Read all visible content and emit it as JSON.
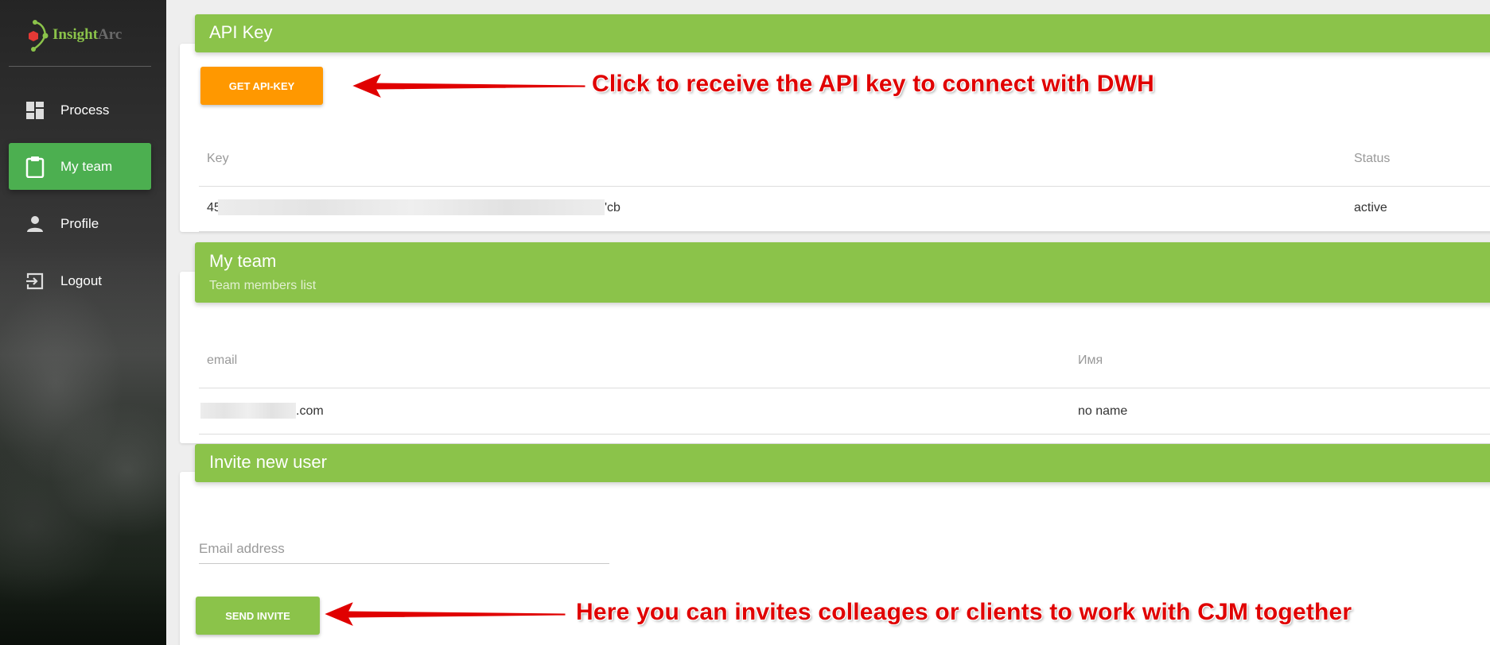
{
  "sidebar": {
    "logo": {
      "part1": "Insight",
      "part2": "Arc"
    },
    "items": [
      {
        "label": "Process",
        "icon": "dashboard-icon",
        "active": false
      },
      {
        "label": "My team",
        "icon": "clipboard-icon",
        "active": true
      },
      {
        "label": "Profile",
        "icon": "person-icon",
        "active": false
      },
      {
        "label": "Logout",
        "icon": "exit-icon",
        "active": false
      }
    ]
  },
  "api_key": {
    "title": "API Key",
    "button_label": "GET API-KEY",
    "columns": {
      "key": "Key",
      "status": "Status"
    },
    "rows": [
      {
        "key_start": "45",
        "key_end": "'cb",
        "status": "active"
      }
    ],
    "annotation": "Click to receive the API key to connect with DWH"
  },
  "team": {
    "title": "My team",
    "subtitle": "Team members list",
    "columns": {
      "email": "email",
      "name": "Имя"
    },
    "rows": [
      {
        "email_end": ".com",
        "name": "no name"
      }
    ]
  },
  "invite": {
    "title": "Invite new user",
    "email_placeholder": "Email address",
    "button_label": "SEND INVITE",
    "annotation": "Here you can invites colleages or clients to work with CJM together"
  },
  "colors": {
    "primary_green": "#8bc34a",
    "active_nav": "#4caf50",
    "orange": "#ff9800",
    "annotation_red": "#e00000"
  }
}
